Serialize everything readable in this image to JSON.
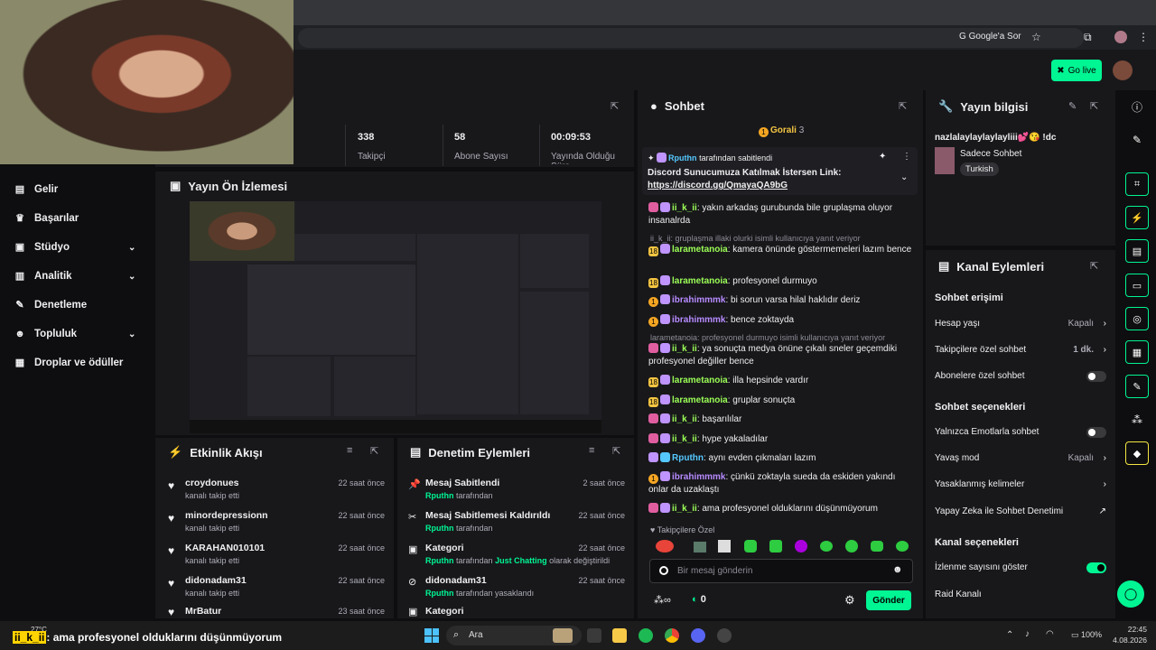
{
  "browser": {
    "google_label": "Google'a Sor"
  },
  "header": {
    "golive_label": "Go live"
  },
  "nav": {
    "items": [
      {
        "label": "Gelir"
      },
      {
        "label": "Başarılar"
      },
      {
        "label": "Stüdyo"
      },
      {
        "label": "Analitik"
      },
      {
        "label": "Denetleme"
      },
      {
        "label": "Topluluk"
      },
      {
        "label": "Droplar ve ödüller"
      }
    ]
  },
  "stats": {
    "followers_num": "338",
    "followers_label": "Takipçi",
    "subs_num": "58",
    "subs_label": "Abone Sayısı",
    "time_num": "00:09:53",
    "time_label": "Yayında Olduğu Süre"
  },
  "preview": {
    "title": "Yayın Ön İzlemesi"
  },
  "activity": {
    "title": "Etkinlik Akışı",
    "rows": [
      {
        "name": "croydonues",
        "sub": "kanalı takip etti",
        "time": "22 saat önce"
      },
      {
        "name": "minordepressionn",
        "sub": "kanalı takip etti",
        "time": "22 saat önce"
      },
      {
        "name": "KARAHAN010101",
        "sub": "kanalı takip etti",
        "time": "22 saat önce"
      },
      {
        "name": "didonadam31",
        "sub": "kanalı takip etti",
        "time": "22 saat önce"
      },
      {
        "name": "MrBatur",
        "sub": "",
        "time": "23 saat önce"
      }
    ]
  },
  "modlog": {
    "title": "Denetim Eylemleri",
    "rows": [
      {
        "title": "Mesaj Sabitlendi",
        "user": "Rputhn",
        "rest": "tarafından",
        "time": "2 saat önce"
      },
      {
        "title": "Mesaj Sabitlemesi Kaldırıldı",
        "user": "Rputhn",
        "rest": "tarafından",
        "time": "22 saat önce"
      },
      {
        "title": "Kategori",
        "user": "Rputhn",
        "rest": "tarafından",
        "extra": "Just Chatting",
        "rest2": "olarak değiştirildi",
        "time": "22 saat önce"
      },
      {
        "title": "didonadam31",
        "user": "Rputhn",
        "rest": "tarafından yasaklandı",
        "time": "22 saat önce"
      },
      {
        "title": "Kategori",
        "user": "",
        "rest": "",
        "time": ""
      }
    ]
  },
  "chat": {
    "title": "Sohbet",
    "gifter": "Gorali",
    "gifter_count": "3",
    "pinned_by": "Rputhn",
    "pinned_suffix": "tarafından sabitlendi",
    "pinned_text": "Discord Sunucumuza Katılmak İstersen Link:",
    "pinned_link": "https://discord.gg/QmayaQA9bG",
    "messages": [
      {
        "user": "ii_k_ii",
        "text": ": yakın arkadaş gurubunda bile gruplaşma oluyor insanalrda"
      },
      {
        "reply": "ii_k_ii: gruplaşma illaki olurki isimli kullanıcıya yanıt veriyor"
      },
      {
        "user": "larametanoia",
        "text": ": kamera önünde göstermemeleri lazım bence"
      },
      {
        "user": "larametanoia",
        "text": ": profesyonel durmuyo"
      },
      {
        "user": "ibrahimmmk",
        "text": ": bi sorun varsa hilal haklıdır deriz"
      },
      {
        "user": "ibrahimmmk",
        "text": ": bence zoktayda"
      },
      {
        "reply": "larametanoia: profesyonel durmuyo isimli kullanıcıya yanıt veriyor"
      },
      {
        "user": "ii_k_ii",
        "text": ": ya sonuçta medya önüne çıkalı sneler geçemdiki profesyonel değiller bence"
      },
      {
        "user": "larametanoia",
        "text": ": illa hepsinde vardır"
      },
      {
        "user": "larametanoia",
        "text": ": gruplar sonuçta"
      },
      {
        "user": "ii_k_ii",
        "text": ": başarılılar"
      },
      {
        "user": "ii_k_ii",
        "text": ": hype yakaladılar"
      },
      {
        "user": "Rputhn",
        "text": ": aynı evden çıkmaları lazım"
      },
      {
        "user": "ibrahimmmk",
        "text": ": çünkü zoktayla sueda da eskiden yakındı onlar da uzaklaştı"
      },
      {
        "user": "ii_k_ii",
        "text": ": ama profesyonel olduklarını düşünmüyorum"
      }
    ],
    "followers_only": "Takipçilere Özel",
    "input_placeholder": "Bir mesaj gönderin",
    "points": "0",
    "send_label": "Gönder"
  },
  "info": {
    "title": "Yayın bilgisi",
    "stream_title": "nazlalaylaylaylayliii💕😘 !dc",
    "category": "Sadece Sohbet",
    "tag": "Turkish"
  },
  "actions": {
    "title": "Kanal Eylemleri",
    "chat_access": "Sohbet erişimi",
    "account_age": "Hesap yaşı",
    "account_age_val": "Kapalı",
    "followers_chat": "Takipçilere özel sohbet",
    "followers_chat_val": "1 dk.",
    "subs_chat": "Abonelere özel sohbet",
    "chat_options": "Sohbet seçenekleri",
    "emote_only": "Yalnızca Emotlarla sohbet",
    "slow_mode": "Yavaş mod",
    "slow_mode_val": "Kapalı",
    "banned_words": "Yasaklanmış kelimeler",
    "ai_mod": "Yapay Zeka ile Sohbet Denetimi",
    "channel_options": "Kanal seçenekleri",
    "show_viewers": "İzlenme sayısını göster",
    "raid": "Raid Kanalı"
  },
  "taskbar": {
    "weather": "27°C",
    "search": "Ara",
    "time": "22:45",
    "date": "4.08.2026",
    "battery": "100%"
  },
  "caption": {
    "user": "ii_k_ii",
    "text": ": ama profesyonel olduklarını düşünmüyorum"
  }
}
